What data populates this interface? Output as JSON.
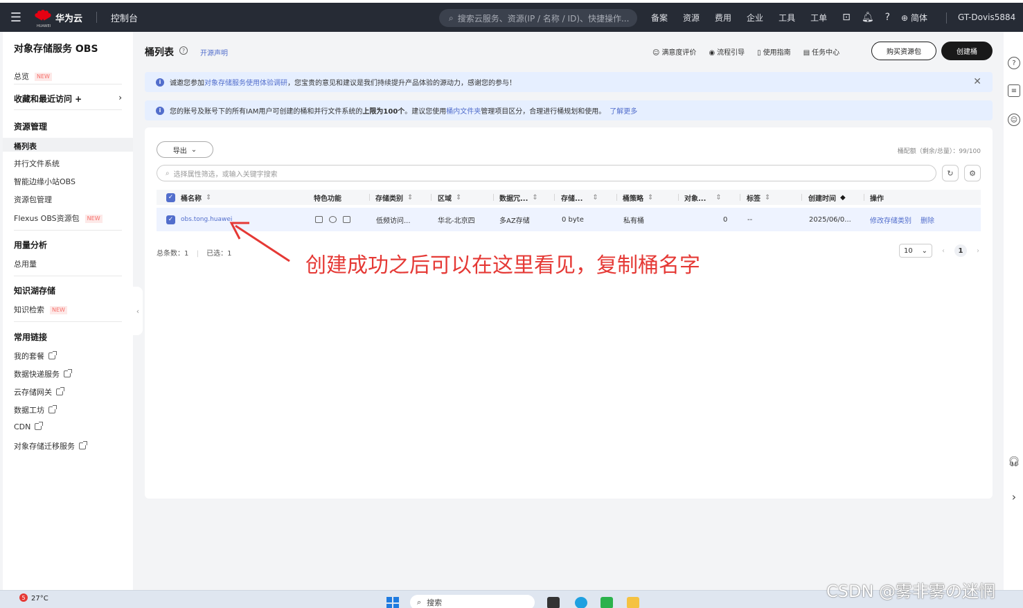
{
  "topnav": {
    "brand": "华为云",
    "brand_sub": "HUAWEI",
    "console": "控制台",
    "search_placeholder": "搜索云服务、资源(IP / 名称 / ID)、快捷操作...",
    "links": [
      "备案",
      "资源",
      "费用",
      "企业",
      "工具",
      "工单"
    ],
    "lang": "简体",
    "user": "GT-Dovis5884"
  },
  "sidebar": {
    "title": "对象存储服务 OBS",
    "overview": "总览",
    "new_badge": "NEW",
    "favorites": "收藏和最近访问 +",
    "groups": {
      "resource": "资源管理",
      "usage": "用量分析",
      "lake": "知识湖存储",
      "links": "常用链接"
    },
    "resource_items": [
      "桶列表",
      "并行文件系统",
      "智能边缘小站OBS",
      "资源包管理",
      "Flexus OBS资源包"
    ],
    "usage_items": [
      "总用量"
    ],
    "lake_items": [
      "知识检索"
    ],
    "link_items": [
      "我的套餐",
      "数据快递服务",
      "云存储网关",
      "数据工坊",
      "CDN",
      "对象存储迁移服务"
    ]
  },
  "header": {
    "title": "桶列表",
    "open_link": "开源声明",
    "tools": [
      "满意度评价",
      "流程引导",
      "使用指南",
      "任务中心"
    ],
    "buy_button": "购买资源包",
    "create_button": "创建桶"
  },
  "notices": {
    "n1_pre": "诚邀您参加",
    "n1_link": "对象存储服务使用体验调研",
    "n1_post": "，您宝贵的意见和建议是我们持续提升产品体验的源动力，感谢您的参与！",
    "n2_pre": "您的账号及账号下的所有IAM用户可创建的桶和并行文件系统的",
    "n2_bold": "上限为100个",
    "n2_mid": "。建议您使用",
    "n2_link": "桶内文件夹",
    "n2_post": "管理项目区分，合理进行桶规划和使用。",
    "n2_more": "了解更多"
  },
  "panel": {
    "export": "导出",
    "quota": "桶配额（剩余/总量）：99/100",
    "filter_placeholder": "选择属性筛选，或输入关键字搜索",
    "columns": [
      "桶名称",
      "特色功能",
      "存储类别",
      "区域",
      "数据冗...",
      "存储...",
      "桶策略",
      "对象...",
      "标签",
      "创建时间",
      "操作"
    ],
    "row": {
      "name": "obs.tong.huawei",
      "storage_class": "低频访问...",
      "region": "华北-北京四",
      "redundancy": "多AZ存储",
      "usage": "0 byte",
      "policy": "私有桶",
      "objects": "0",
      "tags": "--",
      "created": "2025/06/0...",
      "op_modify": "修改存储类别",
      "op_delete": "删除"
    },
    "total": "总条数：1",
    "selected": "已选：1",
    "page_size": "10",
    "page": "1"
  },
  "annotation": "创建成功之后可以在这里看见，复制桶名字",
  "taskbar": {
    "temperature": "27°C",
    "weather_count": "5",
    "search": "搜索"
  },
  "watermark": "CSDN @雾非雾の迷惘",
  "colors": {
    "accent": "#526ecc",
    "nav_bg": "#262b35",
    "annotation": "#e53935"
  }
}
